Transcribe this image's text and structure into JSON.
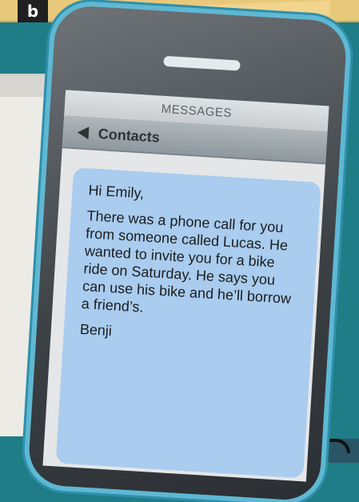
{
  "label": "b",
  "phone": {
    "header_title": "MESSAGES",
    "back_label": "Contacts",
    "message": {
      "greeting": "Hi Emily,",
      "body": "There was a phone call for you from someone called Lucas. He wanted to invite you for a bike ride on Saturday. He says you can use his bike and he’ll borrow a friend’s.",
      "signature": "Benji"
    }
  },
  "colors": {
    "background": "#1e7d86",
    "bubble": "#a9ccef",
    "phone_frame": "#5fb8d3"
  }
}
